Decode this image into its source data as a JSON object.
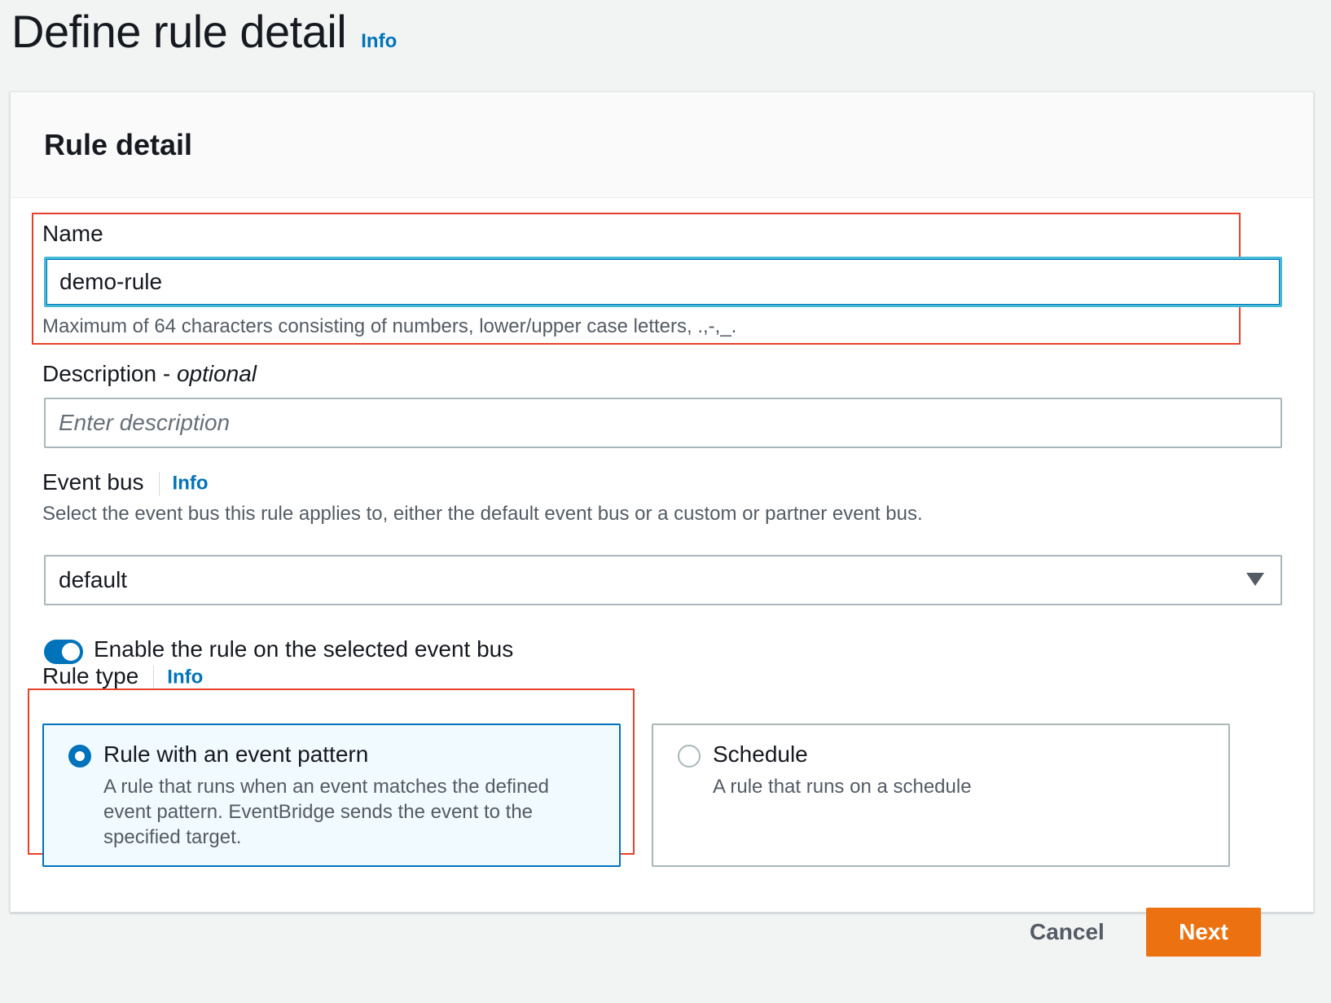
{
  "page": {
    "title": "Define rule detail",
    "info": "Info"
  },
  "panel": {
    "title": "Rule detail"
  },
  "name_field": {
    "label": "Name",
    "value": "demo-rule",
    "hint": "Maximum of 64 characters consisting of numbers, lower/upper case letters, .,-,_."
  },
  "description_field": {
    "label": "Description - ",
    "label_optional": "optional",
    "placeholder": "Enter description"
  },
  "event_bus": {
    "label": "Event bus",
    "info": "Info",
    "hint": "Select the event bus this rule applies to, either the default event bus or a custom or partner event bus.",
    "selected": "default"
  },
  "enable_toggle": {
    "label": "Enable the rule on the selected event bus",
    "on": true
  },
  "rule_type": {
    "label": "Rule type",
    "info": "Info",
    "options": [
      {
        "title": "Rule with an event pattern",
        "description": "A rule that runs when an event matches the defined event pattern. EventBridge sends the event to the specified target.",
        "selected": true
      },
      {
        "title": "Schedule",
        "description": "A rule that runs on a schedule",
        "selected": false
      }
    ]
  },
  "footer": {
    "cancel_label": "Cancel",
    "next_label": "Next"
  },
  "colors": {
    "primary": "#0073bb",
    "next_button": "#ec7211",
    "highlight_box": "#e8412b"
  }
}
